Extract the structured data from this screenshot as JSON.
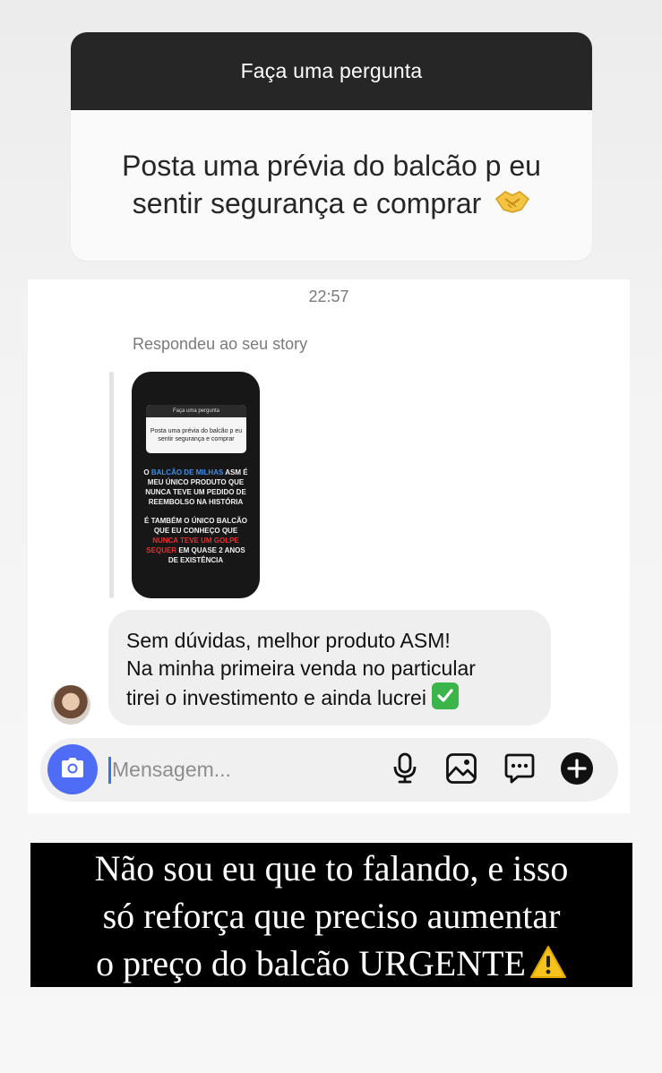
{
  "question_sticker": {
    "header": "Faça uma pergunta",
    "question_text": "Posta uma prévia do balcão p eu sentir segurança e comprar"
  },
  "dm": {
    "timestamp": "22:57",
    "reply_label": "Respondeu ao seu story",
    "story_preview": {
      "mini_header": "Faça uma pergunta",
      "mini_question": "Posta uma prévia do balcão p eu sentir segurança e comprar",
      "block1": {
        "pre": "O ",
        "highlight": "BALCÃO DE MILHAS",
        "post": " ASM É MEU ÚNICO PRODUTO QUE NUNCA TEVE UM PEDIDO DE REEMBOLSO NA HISTÓRIA"
      },
      "block2": {
        "pre": "É TAMBÉM O ÚNICO BALCÃO QUE EU CONHEÇO QUE ",
        "highlight": "NUNCA TEVE UM GOLPE SEQUER",
        "post": " EM QUASE 2 ANOS DE EXISTÊNCIA"
      }
    },
    "message": {
      "line1": "Sem dúvidas, melhor produto ASM!",
      "line2": "Na minha primeira venda no particular",
      "line3": "tirei o investimento e ainda lucrei"
    },
    "composer": {
      "placeholder": "Mensagem..."
    }
  },
  "caption": {
    "line1": "Não sou eu que to falando, e isso",
    "line2": "só reforça que preciso aumentar",
    "line3": "o preço do balcão URGENTE"
  },
  "icons": {
    "handshake": "handshake-emoji",
    "check": "check-mark-button-emoji",
    "warning": "warning-emoji",
    "camera": "camera-icon",
    "mic": "microphone-icon",
    "gallery": "gallery-icon",
    "sticker": "sticker-icon",
    "plus": "plus-icon"
  },
  "colors": {
    "camera_button": "#4e6cf5",
    "bubble": "#efefef",
    "caption_bg": "#000000",
    "highlight_blue": "#3e8ee8",
    "highlight_red": "#e53030"
  }
}
